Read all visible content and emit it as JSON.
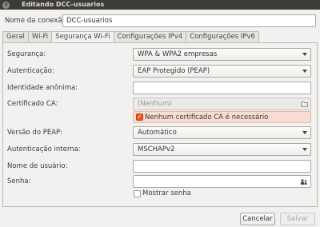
{
  "window": {
    "title": "Editando DCC-usuarios"
  },
  "connection": {
    "name_label": "Nome da conexão:",
    "name_value": "DCC-usuarios"
  },
  "tabs": [
    {
      "label": "Geral"
    },
    {
      "label": "Wi-Fi"
    },
    {
      "label": "Segurança Wi-Fi",
      "active": true
    },
    {
      "label": "Configurações IPv4"
    },
    {
      "label": "Configurações IPv6"
    }
  ],
  "form": {
    "security": {
      "label": "Segurança:",
      "value": "WPA & WPA2 empresas"
    },
    "authentication": {
      "label": "Autenticação:",
      "value": "EAP Protegido (PEAP)"
    },
    "anonymous_identity": {
      "label": "Identidade anônima:",
      "value": ""
    },
    "ca_certificate": {
      "label": "Certificado CA:",
      "value": "(Nenhum)"
    },
    "no_ca_required": {
      "label": "Nenhum certificado CA é necessário",
      "checked": true
    },
    "peap_version": {
      "label": "Versão do PEAP:",
      "value": "Automático"
    },
    "inner_auth": {
      "label": "Autenticação interna:",
      "value": "MSCHAPv2"
    },
    "username": {
      "label": "Nome de usuário:",
      "value": ""
    },
    "password": {
      "label": "Senha:",
      "value": ""
    },
    "show_password": {
      "label": "Mostrar senha",
      "checked": false
    }
  },
  "buttons": {
    "cancel": "Cancelar",
    "save": "Salvar"
  },
  "colors": {
    "accent": "#e95420",
    "titlebar": "#3c3b37",
    "warning_bg": "#f6dcd3"
  }
}
